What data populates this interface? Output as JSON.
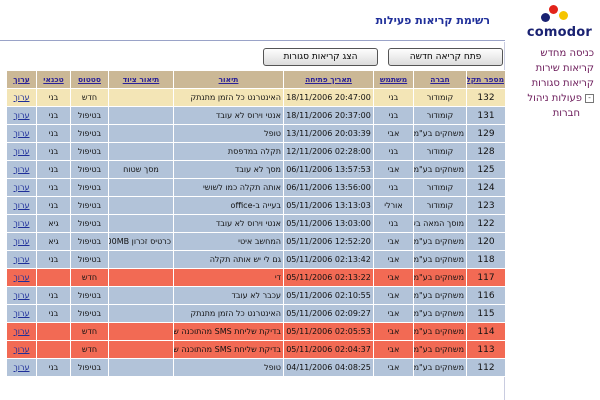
{
  "header": {
    "title": "רשימת קריאות פעילות",
    "logo_text": "comodor"
  },
  "sidebar": {
    "items": [
      {
        "label": "כניסה מחדש"
      },
      {
        "label": "קריאות שירות"
      },
      {
        "label": "קריאות סגורות"
      },
      {
        "label": "פעולות ניהול",
        "expander": "-"
      },
      {
        "label": "חברות"
      }
    ]
  },
  "toolbar": {
    "new_call": "פתח קריאה חדשה",
    "show_closed": "הצג קריאות סגורות"
  },
  "table": {
    "columns": [
      "מספר תקלה",
      "חברה",
      "משתמש",
      "תאריך פתיחה",
      "תיאור",
      "תיאור ציוד",
      "סטטוס",
      "טכנאי",
      "ערוך"
    ],
    "edit_label": "ערוך",
    "rows": [
      {
        "num": "132",
        "company": "קומודור",
        "user": "בני",
        "date": "20:47:00 18/11/2006",
        "desc": "האינטרנט כל הזמן מתנתק",
        "equip": "",
        "status": "חדש",
        "tech": "בני",
        "type": "new"
      },
      {
        "num": "131",
        "company": "קומודור",
        "user": "בני",
        "date": "20:37:00 18/11/2006",
        "desc": "אנטי וירוס לא עובד",
        "equip": "",
        "status": "בטיפול",
        "tech": "בני",
        "type": "progress"
      },
      {
        "num": "129",
        "company": "משחקים בע\"מ",
        "user": "אבי",
        "date": "20:03:39 13/11/2006",
        "desc": "טופל",
        "equip": "",
        "status": "בטיפול",
        "tech": "בני",
        "type": "progress"
      },
      {
        "num": "128",
        "company": "קומודור",
        "user": "בני",
        "date": "02:28:00 12/11/2006",
        "desc": "תקלה במדפסת",
        "equip": "",
        "status": "בטיפול",
        "tech": "בני",
        "type": "progress"
      },
      {
        "num": "125",
        "company": "משחקים בע\"מ",
        "user": "אבי",
        "date": "13:57:53 06/11/2006",
        "desc": "מסך לא עובד",
        "equip": "מסך שטוח",
        "status": "בטיפול",
        "tech": "בני",
        "type": "progress"
      },
      {
        "num": "124",
        "company": "קומודור",
        "user": "בני",
        "date": "13:56:00 06/11/2006",
        "desc": "אותה תקלה כמו לשושי",
        "equip": "",
        "status": "בטיפול",
        "tech": "בני",
        "type": "progress"
      },
      {
        "num": "123",
        "company": "קומודור",
        "user": "אורלי",
        "date": "13:13:03 05/11/2006",
        "desc": "בעייה ב-office",
        "equip": "",
        "status": "בטיפול",
        "tech": "בני",
        "type": "progress"
      },
      {
        "num": "122",
        "company": "מוסך המאה בע\"מ",
        "user": "בני",
        "date": "13:03:00 05/11/2006",
        "desc": "אנטי וירוס לא עובד",
        "equip": "",
        "status": "בטיפול",
        "tech": "גיא",
        "type": "progress"
      },
      {
        "num": "120",
        "company": "משחקים בע\"מ",
        "user": "אבי",
        "date": "12:52:20 05/11/2006",
        "desc": "המחשב איטי",
        "equip": "כרטיס זכרון 500MB",
        "status": "בטיפול",
        "tech": "גיא",
        "type": "progress"
      },
      {
        "num": "118",
        "company": "משחקים בע\"מ",
        "user": "אבי",
        "date": "02:13:42 05/11/2006",
        "desc": "גם לי יש אותה תקלה",
        "equip": "",
        "status": "בטיפול",
        "tech": "בני",
        "type": "progress"
      },
      {
        "num": "117",
        "company": "משחקים בע\"מ",
        "user": "אבי",
        "date": "02:13:22 05/11/2006",
        "desc": "די",
        "equip": "",
        "status": "חדש",
        "tech": "",
        "type": "urgent"
      },
      {
        "num": "116",
        "company": "משחקים בע\"מ",
        "user": "אבי",
        "date": "02:10:55 05/11/2006",
        "desc": "עכבר לא עובד",
        "equip": "",
        "status": "בטיפול",
        "tech": "בני",
        "type": "progress"
      },
      {
        "num": "115",
        "company": "משחקים בע\"מ",
        "user": "אבי",
        "date": "02:09:27 05/11/2006",
        "desc": "האינטרנט כל הזמן מתנתק",
        "equip": "",
        "status": "בטיפול",
        "tech": "בני",
        "type": "progress"
      },
      {
        "num": "114",
        "company": "משחקים בע\"מ",
        "user": "אבי",
        "date": "02:05:53 05/11/2006",
        "desc": "בדיקת שליחת SMS מהתוכנה שלנו",
        "equip": "",
        "status": "חדש",
        "tech": "",
        "type": "urgent"
      },
      {
        "num": "113",
        "company": "משחקים בע\"מ",
        "user": "אבי",
        "date": "02:04:37 05/11/2006",
        "desc": "בדיקת שליחת SMS מהתוכנה שלנו",
        "equip": "",
        "status": "חדש",
        "tech": "",
        "type": "urgent"
      },
      {
        "num": "112",
        "company": "משחקים בע\"מ",
        "user": "אבי",
        "date": "04:08:25 04/11/2006",
        "desc": "טופל",
        "equip": "",
        "status": "בטיפול",
        "tech": "בני",
        "type": "progress"
      }
    ]
  },
  "colors": {
    "header_bg": "#cbb896",
    "row_new": "#f3e5b6",
    "row_in_progress": "#b2c3d9",
    "row_urgent": "#f26a54",
    "link": "#1f2f9a",
    "sidebar_text": "#6a1858"
  }
}
